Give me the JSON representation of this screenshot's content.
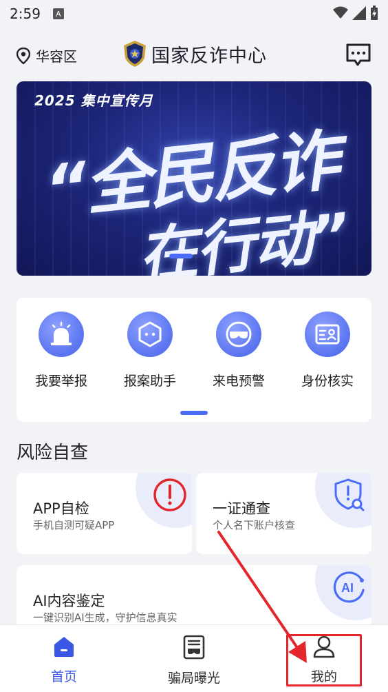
{
  "status_bar": {
    "time": "2:59",
    "notif_letter": "A"
  },
  "header": {
    "location": "华容区",
    "title": "国家反诈中心"
  },
  "banner": {
    "subtitle": "2025  集中宣传月",
    "line1": "“全民反诈",
    "line2": "在行动”"
  },
  "actions": [
    {
      "label": "我要举报",
      "icon": "alarm-icon"
    },
    {
      "label": "报案助手",
      "icon": "hexagon-face-icon"
    },
    {
      "label": "来电预警",
      "icon": "mask-icon"
    },
    {
      "label": "身份核实",
      "icon": "id-card-icon"
    }
  ],
  "section": {
    "title": "风险自查"
  },
  "risk_cards": [
    {
      "title": "APP自检",
      "subtitle": "手机自测可疑APP",
      "icon": "warning-circle-icon"
    },
    {
      "title": "一证通查",
      "subtitle": "个人名下账户核查",
      "icon": "shield-search-icon"
    },
    {
      "title": "AI内容鉴定",
      "subtitle": "一键识别AI生成，守护信息真实",
      "icon": "ai-icon"
    }
  ],
  "bottom_nav": [
    {
      "label": "首页",
      "icon": "home-icon",
      "active": true
    },
    {
      "label": "骗局曝光",
      "icon": "newspaper-icon",
      "active": false
    },
    {
      "label": "我的",
      "icon": "user-icon",
      "active": false
    }
  ],
  "colors": {
    "accent": "#4a6cf7",
    "annotation": "#e3262b",
    "nav_active": "#3b57e6"
  }
}
